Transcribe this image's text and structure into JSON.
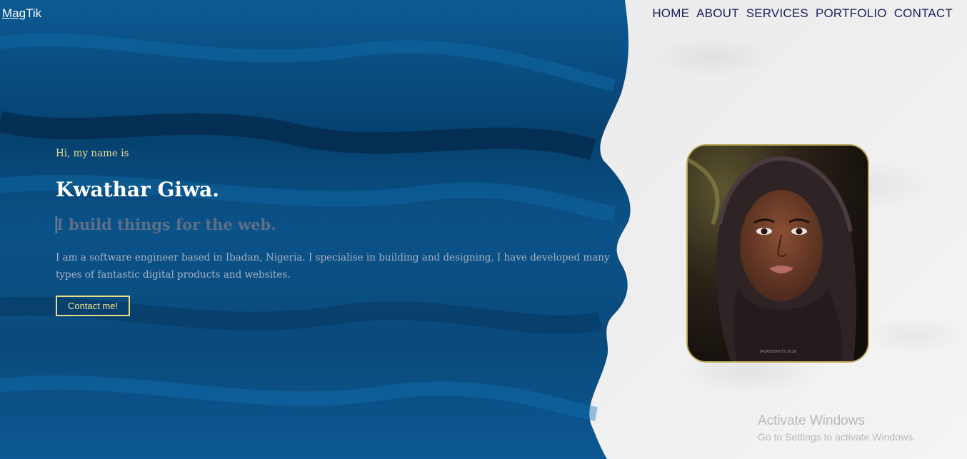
{
  "brand": {
    "part1": "Mag",
    "part2": "Tik"
  },
  "nav": {
    "items": [
      "HOME",
      "ABOUT",
      "SERVICES",
      "PORTFOLIO",
      "CONTACT"
    ]
  },
  "hero": {
    "greeting": "Hi, my name is",
    "name": "Kwathar Giwa.",
    "tagline": "I build things for the web.",
    "description": "I am a software engineer based in Ibadan, Nigeria. I specialise in building and designing, I have developed many types of fantastic digital products and websites.",
    "button_label": "Contact me!"
  },
  "portrait": {
    "photo_credit": "TAURUSSHOTS 2019"
  },
  "watermark": {
    "title": "Activate Windows",
    "subtitle": "Go to Settings to activate Windows."
  },
  "colors": {
    "paint_blue": "#0a4f86",
    "nav_text": "#1c1d5c",
    "accent_yellow": "#e6dc8a",
    "portrait_border": "#b7a856"
  }
}
